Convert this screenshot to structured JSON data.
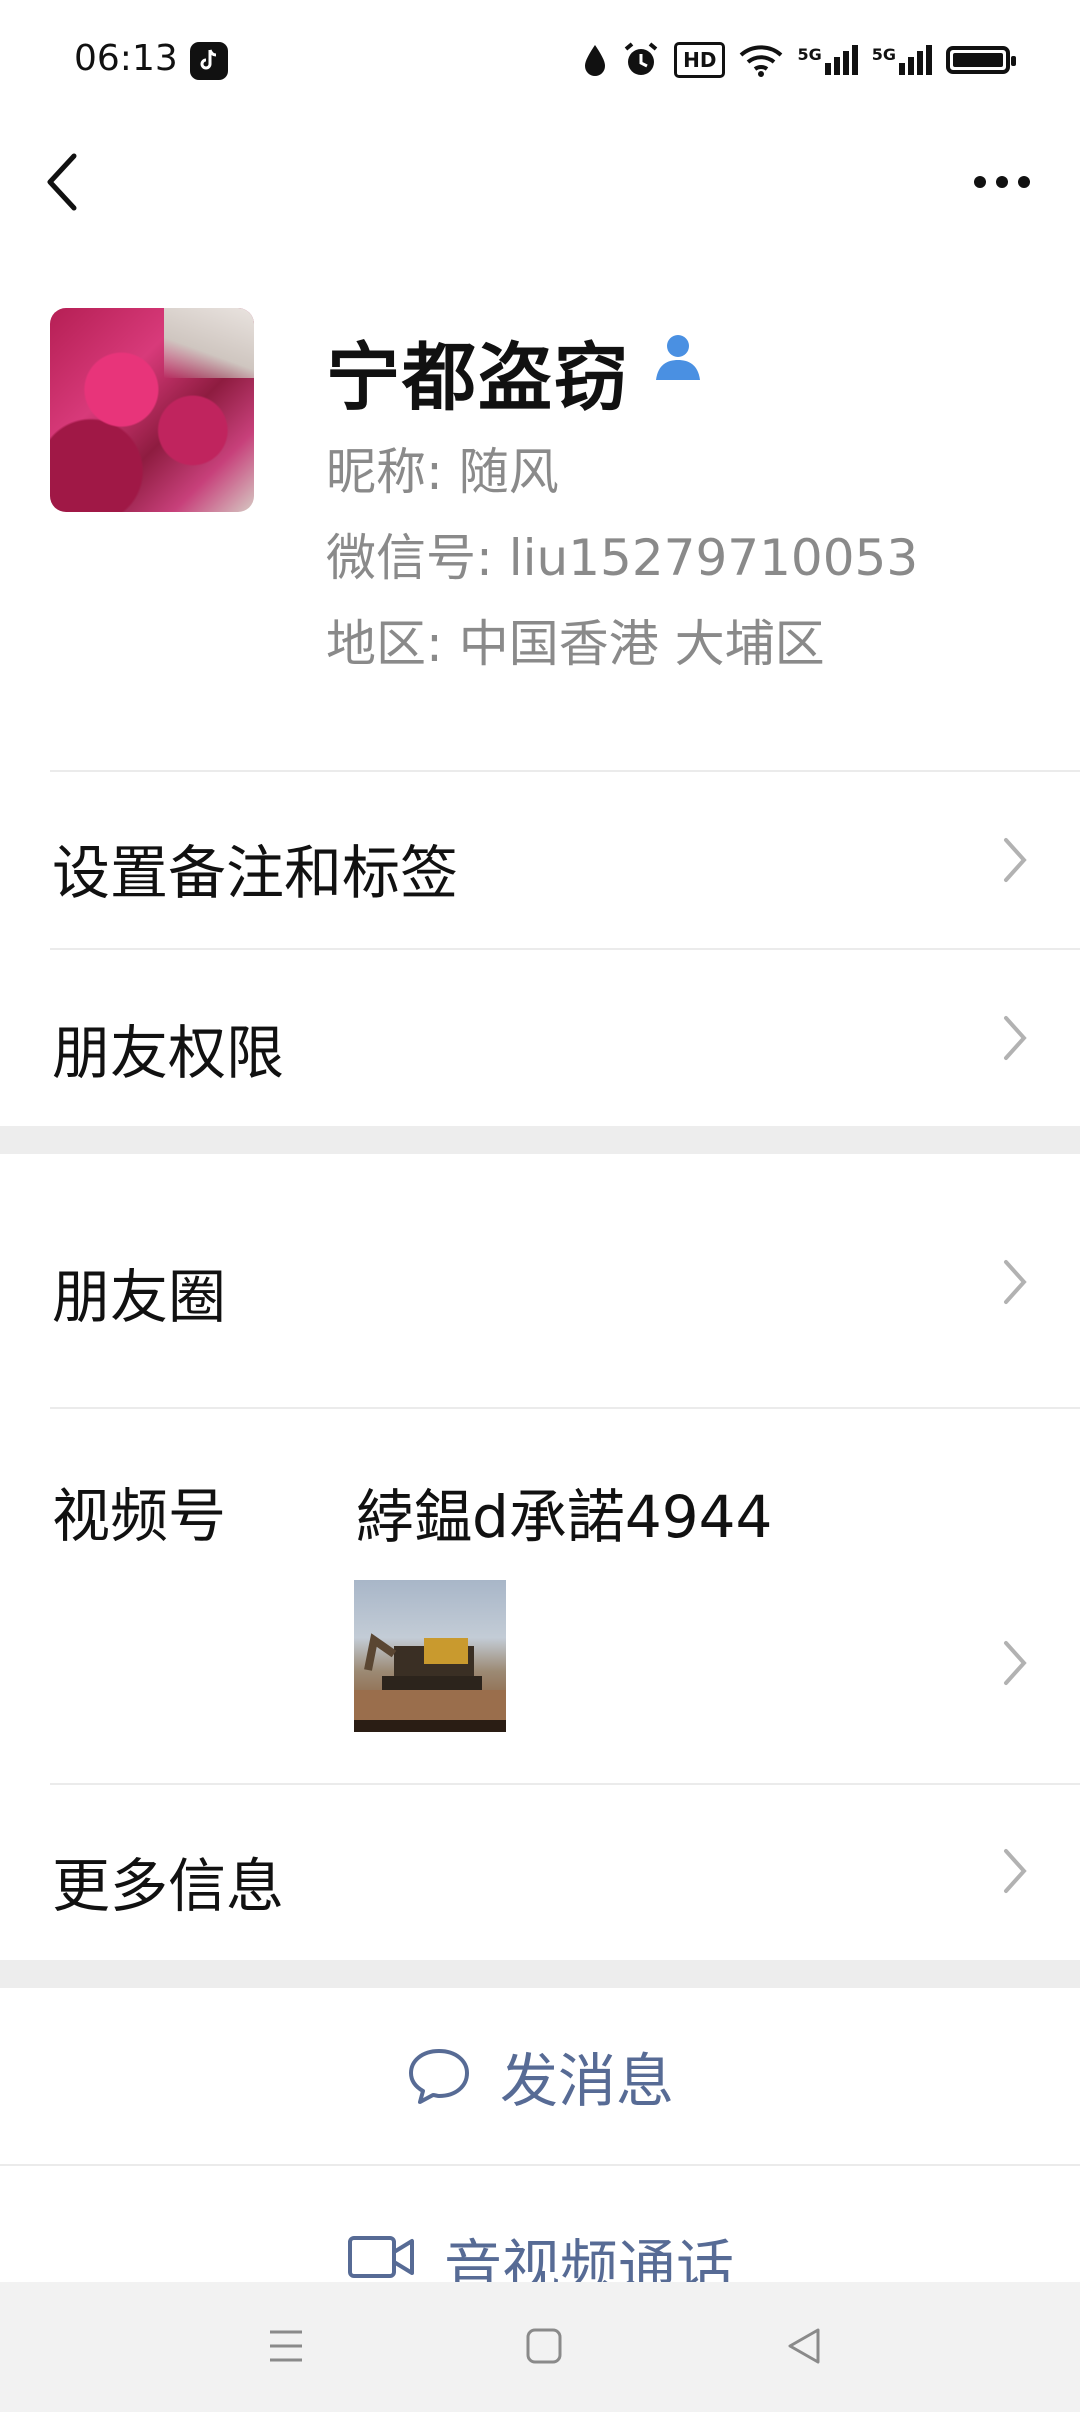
{
  "status_bar": {
    "time": "06:13",
    "indicators": [
      "droplet-icon",
      "alarm-icon",
      "hd-icon",
      "wifi-icon",
      "signal-5g-icon",
      "signal-5g-icon",
      "battery-icon"
    ],
    "hd_label": "HD",
    "network_label": "5G"
  },
  "header": {
    "back_icon": "chevron-left-icon",
    "more_icon": "more-dots-icon"
  },
  "profile": {
    "name": "宁都盗窃",
    "nickname": "昵称:  随风",
    "wechat_id": "微信号:  liu15279710053",
    "region": "地区:  中国香港  大埔区"
  },
  "menu": {
    "remark_tags": "设置备注和标签",
    "friend_permissions": "朋友权限",
    "moments": "朋友圈",
    "channels": "视频号",
    "channels_name": "綍鎾d承諾4944",
    "more_info": "更多信息"
  },
  "actions": {
    "send_message": "发消息",
    "av_call": "音视频通话"
  },
  "colors": {
    "accent_link": "#576b95",
    "verified_blue": "#4a90e2",
    "section_gap": "#ededed"
  }
}
